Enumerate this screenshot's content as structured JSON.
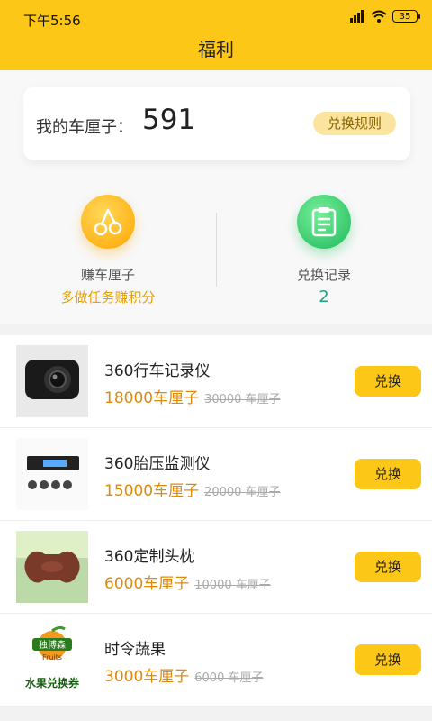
{
  "status": {
    "time": "下午5:56",
    "battery": "35"
  },
  "header": {
    "title": "福利"
  },
  "points_card": {
    "label": "我的车厘子：",
    "value": "591",
    "rules_label": "兑换规则"
  },
  "actions": [
    {
      "name": "赚车厘子",
      "sub": "多做任务赚积分"
    },
    {
      "name": "兑换记录",
      "sub": "2"
    }
  ],
  "products": [
    {
      "name": "360行车记录仪",
      "price": "18000车厘子",
      "original": "30000 车厘子",
      "button": "兑换"
    },
    {
      "name": "360胎压监测仪",
      "price": "15000车厘子",
      "original": "20000 车厘子",
      "button": "兑换"
    },
    {
      "name": "360定制头枕",
      "price": "6000车厘子",
      "original": "10000 车厘子",
      "button": "兑换"
    },
    {
      "name": "时令蔬果",
      "price": "3000车厘子",
      "original": "6000 车厘子",
      "button": "兑换"
    }
  ],
  "product_images": {
    "fruit_voucher_top": "独博森",
    "fruit_voucher_fruits": "Fruits",
    "fruit_voucher_bottom": "水果兑换券"
  },
  "colors": {
    "accent": "#fcc716",
    "price": "#e08a0b",
    "teal": "#1aa37c"
  }
}
